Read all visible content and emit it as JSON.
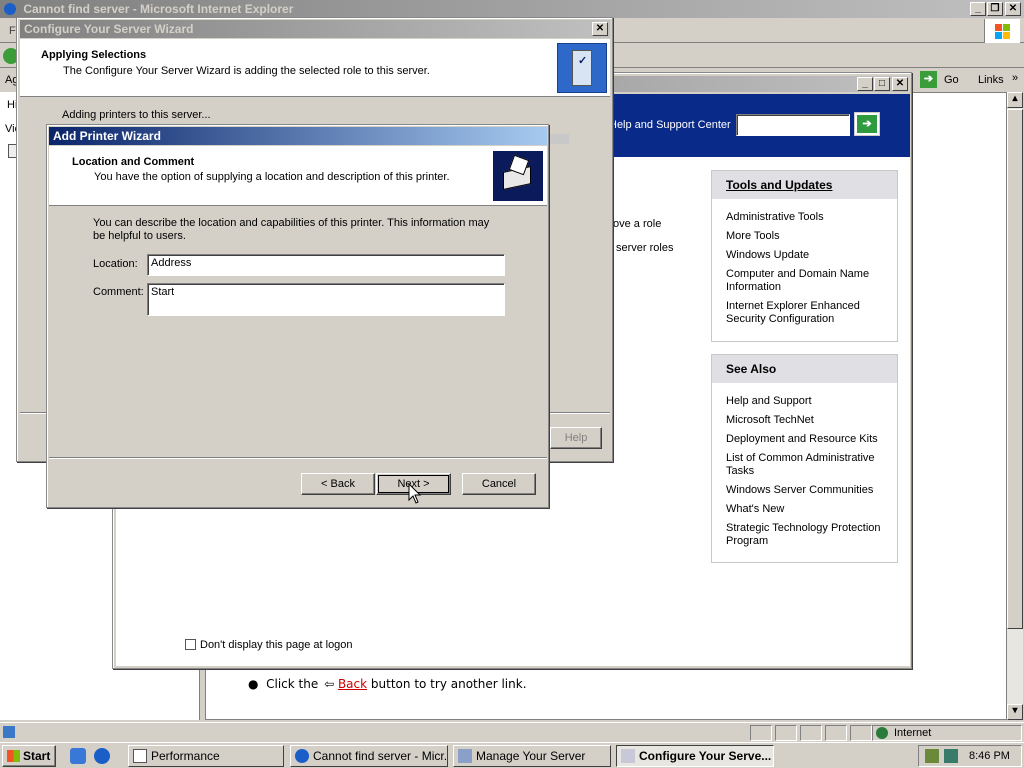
{
  "ie": {
    "title": "Cannot find server - Microsoft Internet Explorer",
    "menu_first": "F",
    "go_label": "Go",
    "links_label": "Links",
    "side_labels": [
      "Ag",
      "Hi",
      "Vie"
    ],
    "back_text_before": "Click the",
    "back_link": "Back",
    "back_text_after": "button to try another link.",
    "status_zone": "Internet"
  },
  "mys": {
    "help_center": "Help and Support Center",
    "search_value": "",
    "frag1": "ove a role",
    "frag2": "server roles",
    "tools_title": "Tools and Updates",
    "tools_links": [
      "Administrative Tools",
      "More Tools",
      "Windows Update",
      "Computer and Domain Name Information",
      "Internet Explorer Enhanced Security Configuration"
    ],
    "see_also_title": "See Also",
    "see_also_links": [
      "Help and Support",
      "Microsoft TechNet",
      "Deployment and Resource Kits",
      "List of Common Administrative Tasks",
      "Windows Server Communities",
      "What's New",
      "Strategic Technology Protection Program"
    ],
    "dont_display": "Don't display this page at logon"
  },
  "cysw": {
    "title": "Configure Your Server Wizard",
    "heading": "Applying Selections",
    "subheading": "The Configure Your Server Wizard is adding the selected role to this server.",
    "status": "Adding printers to this server...",
    "help_button": "Help"
  },
  "apw": {
    "title": "Add Printer Wizard",
    "heading": "Location and Comment",
    "subheading": "You have the option of supplying a location and description of this printer.",
    "description": "You can describe the location and capabilities of this printer. This information may be helpful to users.",
    "location_label": "Location:",
    "location_value": "Address",
    "comment_label": "Comment:",
    "comment_value": "Start",
    "back_button": "< Back",
    "next_button": "Next >",
    "cancel_button": "Cancel"
  },
  "taskbar": {
    "start": "Start",
    "tasks": [
      "Performance",
      "Cannot find server - Micr...",
      "Manage Your Server",
      "Configure Your Serve..."
    ],
    "clock": "8:46 PM"
  }
}
